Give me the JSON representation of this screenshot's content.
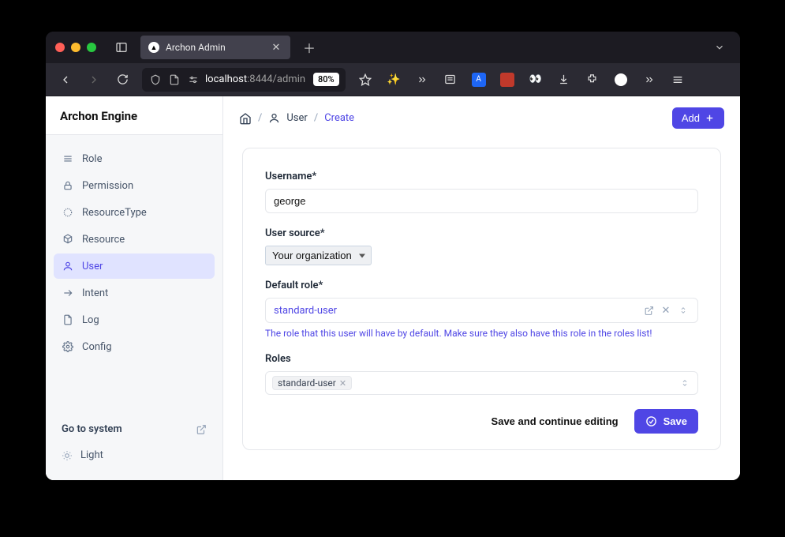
{
  "browser": {
    "tab_title": "Archon Admin",
    "url_host": "localhost",
    "url_rest": ":8444/admin",
    "zoom": "80%"
  },
  "app": {
    "title": "Archon Engine",
    "sidebar": [
      {
        "label": "Role"
      },
      {
        "label": "Permission"
      },
      {
        "label": "ResourceType"
      },
      {
        "label": "Resource"
      },
      {
        "label": "User"
      },
      {
        "label": "Intent"
      },
      {
        "label": "Log"
      },
      {
        "label": "Config"
      }
    ],
    "footer": {
      "goto": "Go to system",
      "theme": "Light"
    }
  },
  "breadcrumb": {
    "user": "User",
    "create": "Create"
  },
  "header": {
    "add": "Add"
  },
  "form": {
    "username_label": "Username*",
    "username_value": "george",
    "source_label": "User source*",
    "source_value": "Your organization",
    "default_role_label": "Default role*",
    "default_role_value": "standard-user",
    "default_role_help": "The role that this user will have by default. Make sure they also have this role in the roles list!",
    "roles_label": "Roles",
    "roles_tag": "standard-user"
  },
  "actions": {
    "save_continue": "Save and continue editing",
    "save": "Save"
  }
}
